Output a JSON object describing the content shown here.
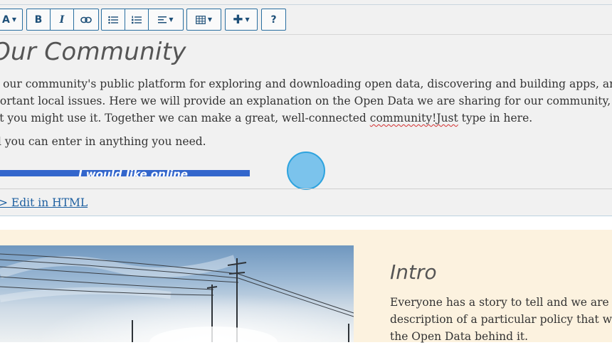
{
  "toolbar": {
    "font_label": "A",
    "bold_label": "B",
    "italic_label": "I",
    "help_label": "?"
  },
  "content": {
    "heading": "Our Community",
    "paragraph_lines": [
      "e our community's public platform for exploring and downloading open data, discovering and building apps, and",
      "portant local issues. Here we will provide an explanation on the Open Data we are sharing for our community, ho"
    ],
    "paragraph_line3_before": "at you might use it. Together we can make a great, well-connected ",
    "paragraph_line3_misspelled": "community!Just",
    "paragraph_line3_after": " type in here.",
    "line2": "d you can enter in anything you need.",
    "blue_bar_text": "I would like online"
  },
  "edit_link": "> Edit in HTML",
  "preview": {
    "intro_title": "Intro",
    "intro_lines": [
      "Everyone has a story to tell and we are no",
      "description of a particular policy that we",
      "the Open Data behind it."
    ]
  },
  "colors": {
    "accent": "#2a6fa0",
    "highlight_bar": "#3366cc",
    "preview_bg": "#fcf2df",
    "cursor": "#6ebeeb"
  },
  "icons": [
    "caret-down-icon",
    "link-icon",
    "bulleted-list-icon",
    "numbered-list-icon",
    "align-icon",
    "table-icon",
    "plus-icon"
  ]
}
